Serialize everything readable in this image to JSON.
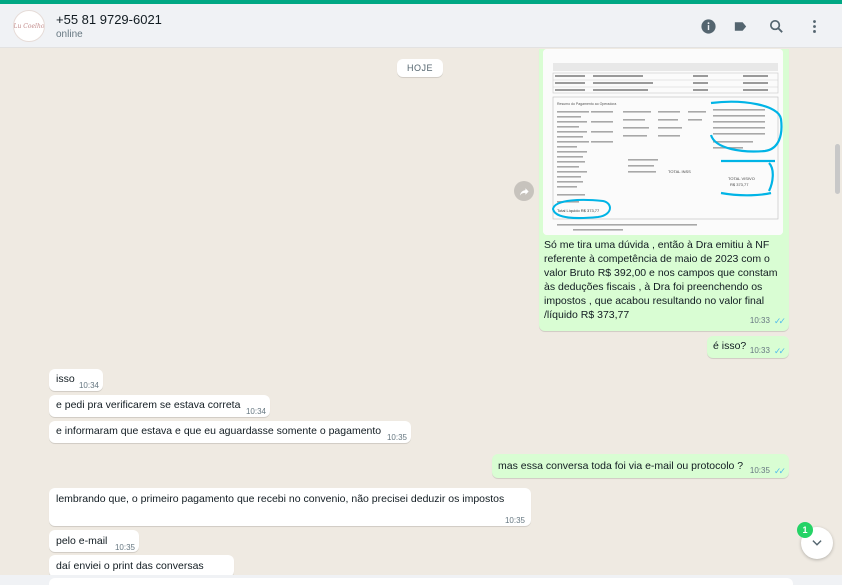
{
  "header": {
    "avatar_label": "Lu Coelho",
    "contact_name": "+55 81 9729-6021",
    "status": "online",
    "icons": [
      "info-icon",
      "label-icon",
      "search-icon",
      "menu-icon"
    ]
  },
  "chat": {
    "day_label": "HOJE",
    "document": {
      "section_title": "Resumo do Pagamento ao Operadora",
      "total_liquido_handwritten": "Total Líquido  R$ 373,77",
      "bottom_note": "O valor líquido acima será creditado em sua conta corrente no Banco indicado em:",
      "bank_rows": [
        "Data do Crédito: 11/05/2023",
        "Banco: BANCO ALENIAM",
        "Agência: 0001",
        "Conta Corrente: 946883334"
      ],
      "right_labels": [
        "TOTAL INSS",
        "TOTAL VISIVO",
        "R$ 373,77"
      ]
    },
    "messages": [
      {
        "dir": "out",
        "text": "Só me tira uma dúvida , então à Dra emitiu à NF referente à competência de maio de 2023 com o valor Bruto R$ 392,00 e nos campos que constam às deduções fiscais , à Dra foi preenchendo os impostos , que acabou resultando no valor final /líquido R$ 373,77",
        "time": "10:33"
      },
      {
        "dir": "out",
        "text": "é isso?",
        "time": "10:33"
      },
      {
        "dir": "in",
        "text": "isso",
        "time": "10:34"
      },
      {
        "dir": "in",
        "text": "e pedi pra verificarem se estava correta",
        "time": "10:34"
      },
      {
        "dir": "in",
        "text": "e informaram que estava e que eu aguardasse somente o pagamento",
        "time": "10:35"
      },
      {
        "dir": "out",
        "text": "mas essa conversa toda foi via e-mail ou protocolo ?",
        "time": "10:35"
      },
      {
        "dir": "in",
        "text": "lembrando que, o primeiro pagamento que recebi no convenio, não precisei deduzir os impostos",
        "time": "10:35"
      },
      {
        "dir": "in",
        "text": "pelo e-mail",
        "time": "10:35"
      },
      {
        "dir": "in",
        "text": "daí enviei o print das conversas",
        "time": ""
      }
    ]
  },
  "unread_count": "1",
  "colors": {
    "accent": "#00a884",
    "outgoing": "#d9fdd3",
    "incoming": "#ffffff",
    "read_ticks": "#53bdeb",
    "annotation": "#00b4e6"
  }
}
